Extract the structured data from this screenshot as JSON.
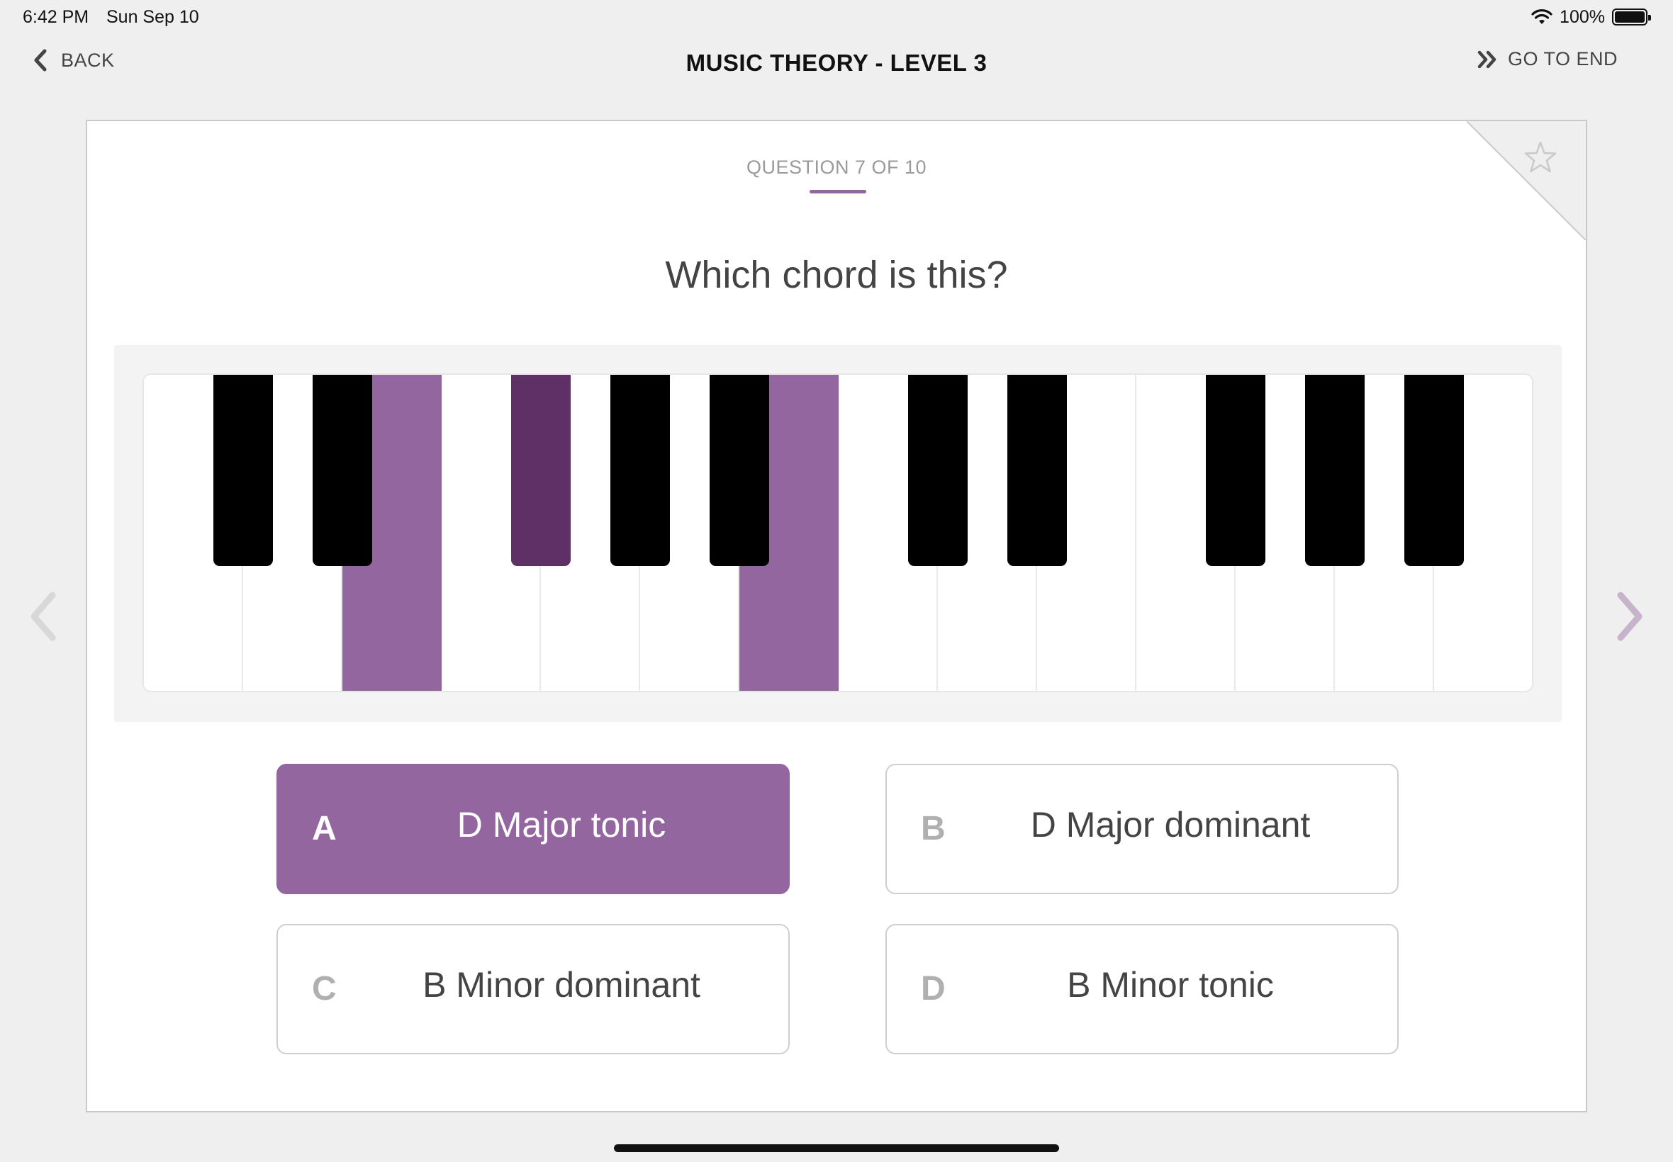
{
  "status_bar": {
    "time": "6:42 PM",
    "date": "Sun Sep 10",
    "battery": "100%",
    "icons": [
      "wifi-icon",
      "battery-icon"
    ]
  },
  "nav": {
    "back_label": "BACK",
    "back_icon": "chevron-left-icon",
    "title": "MUSIC THEORY - LEVEL 3",
    "go_to_end_label": "GO TO END",
    "go_to_end_icon": "double-chevron-right-icon"
  },
  "quiz": {
    "question_counter": "QUESTION 7 OF 10",
    "question": "Which chord is this?",
    "bookmark_icon": "star-icon",
    "accent_color": "#9466a0"
  },
  "keyboard": {
    "white_keys": 14,
    "black_key_slots": [
      1,
      2,
      4,
      5,
      6,
      8,
      9,
      11,
      12,
      13
    ],
    "highlighted_white_keys": [
      2,
      6
    ],
    "highlighted_black_keys": [
      4
    ],
    "highlight_color": "#9466a0",
    "highlight_black_color": "#5e3066"
  },
  "answers": [
    {
      "letter": "A",
      "label": "D Major tonic",
      "selected": true
    },
    {
      "letter": "B",
      "label": "D Major dominant",
      "selected": false
    },
    {
      "letter": "C",
      "label": "B Minor dominant",
      "selected": false
    },
    {
      "letter": "D",
      "label": "B Minor tonic",
      "selected": false
    }
  ],
  "navigation": {
    "previous_icon": "chevron-left-icon",
    "next_icon": "chevron-right-icon"
  }
}
